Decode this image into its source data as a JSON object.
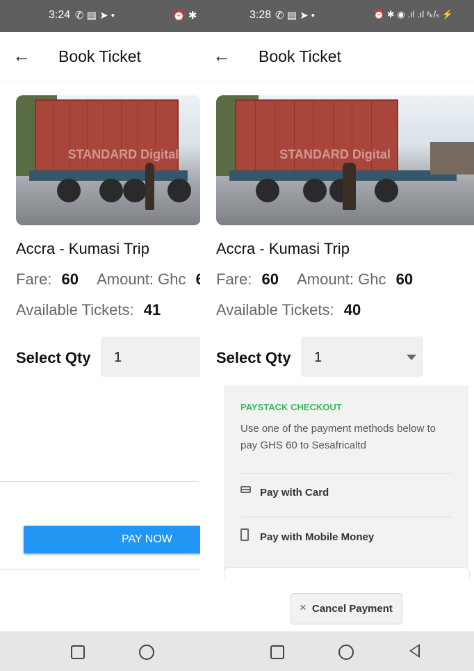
{
  "left_screen": {
    "status_time": "3:24",
    "status_icons_left": "✆ ▤ ➤ •",
    "status_icons_right": "⏰ ✱",
    "title": "Book Ticket",
    "image_watermark": "STANDARD Digital",
    "trip": "Accra - Kumasi Trip",
    "fare_label": "Fare:",
    "fare_value": "60",
    "amount_label": "Amount: Ghc",
    "amount_value": "6",
    "available_label": "Available Tickets:",
    "available_value": "41",
    "qty_label": "Select Qty",
    "qty_value": "1",
    "pay_button": "PAY NOW"
  },
  "right_screen": {
    "status_time": "3:28",
    "status_icons_left": "✆ ▤ ➤ •",
    "status_icons_right": "⏰ ✱ ◉ .ıl .ıl ²ₖ/ₛ ⚡",
    "title": "Book Ticket",
    "image_watermark": "STANDARD Digital",
    "trip": "Accra - Kumasi Trip",
    "fare_label": "Fare:",
    "fare_value": "60",
    "amount_label": "Amount: Ghc",
    "amount_value": "60",
    "available_label": "Available Tickets:",
    "available_value": "40",
    "qty_label": "Select Qty",
    "qty_value": "1",
    "checkout": {
      "title": "PAYSTACK CHECKOUT",
      "description": "Use one of the payment methods below to pay GHS 60 to Sesafricaltd",
      "methods": [
        {
          "label": "Pay with Card",
          "icon": "card-icon"
        },
        {
          "label": "Pay with Mobile Money",
          "icon": "mobile-money-icon"
        }
      ],
      "cancel_button": "Cancel Payment",
      "accent_color": "#3bb75e"
    }
  },
  "icons": {
    "back": "←",
    "cancel": "×"
  },
  "colors": {
    "status_bar": "#5f5f5f",
    "pay_button": "#2196f3",
    "checkout_background": "#f2f2f2",
    "nav_bar": "#e6e6e6"
  },
  "navbar": {
    "buttons": [
      "recent-apps-icon",
      "home-icon",
      "back-icon"
    ]
  }
}
